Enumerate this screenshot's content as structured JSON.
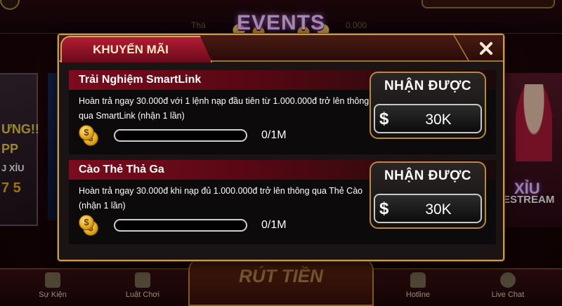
{
  "background": {
    "events_title": "EVENTS",
    "top_text_left": "Thá",
    "top_text_right": "0.000",
    "left_card_text_1": "ƯNG!!",
    "left_card_text_2": "PP",
    "left_card_text_3": "J XỈU",
    "left_card_text_4": "7 5",
    "right_card_text_1": "XỈU",
    "right_card_text_2": "ESTREAM",
    "withdraw_button": "RÚT TIỀN"
  },
  "bottom_nav": [
    {
      "label": "Sự Kiện",
      "icon": "megaphone-icon"
    },
    {
      "label": "Luật Chơi",
      "icon": "book-icon"
    },
    {
      "label": "Hotline",
      "icon": "phone-icon"
    },
    {
      "label": "Live Chat",
      "icon": "chat-icon"
    }
  ],
  "modal": {
    "tab_label": "KHUYẾN MÃI",
    "close_icon": "close-icon",
    "promotions": [
      {
        "title": "Trải Nghiệm SmartLink",
        "description": "Hoàn trả ngay 30.000đ với 1 lệnh nạp đầu tiên từ 1.000.000đ trở lên thông qua SmartLink (nhận 1 lần)",
        "progress_text": "0/1M",
        "progress_fraction": 0,
        "claim_label": "NHẬN ĐƯỢC",
        "currency_symbol": "$",
        "claim_amount": "30K"
      },
      {
        "title": "Cào Thẻ Thả Ga",
        "description": "Hoàn trả ngay 30.000đ khi nạp đủ 1.000.000đ trở lên thông qua Thẻ Cào (nhận 1 lần)",
        "progress_text": "0/1M",
        "progress_fraction": 0,
        "claim_label": "NHẬN ĐƯỢC",
        "currency_symbol": "$",
        "claim_amount": "30K"
      }
    ]
  },
  "colors": {
    "gold_border": "#c79c52",
    "tab_red": "#b21c34",
    "title_bar_red": "#7a0c1e",
    "panel_dark": "#0c0a0a"
  }
}
